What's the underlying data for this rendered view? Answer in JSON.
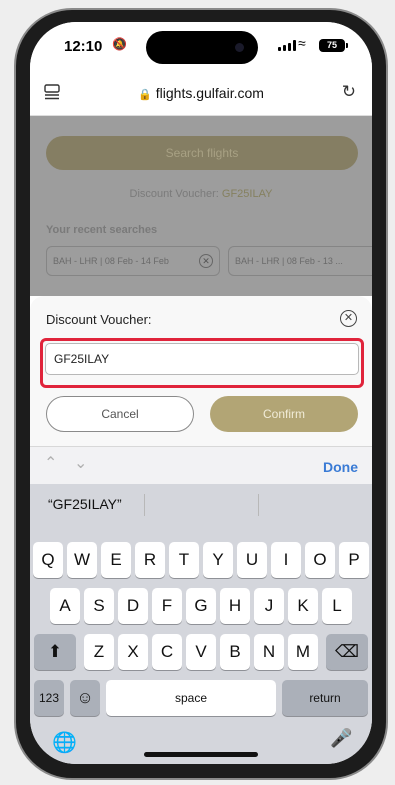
{
  "status_bar": {
    "time": "12:10",
    "battery": "75"
  },
  "browser": {
    "url": "flights.gulfair.com"
  },
  "page": {
    "search_button": "Search flights",
    "discount_label": "Discount Voucher:",
    "discount_code": "GF25ILAY",
    "recent_title": "Your recent searches",
    "recent_searches": [
      "BAH - LHR | 08 Feb - 14 Feb",
      "BAH - LHR | 08 Feb - 13 ..."
    ]
  },
  "dialog": {
    "title": "Discount Voucher:",
    "input_value": "GF25ILAY",
    "cancel_label": "Cancel",
    "confirm_label": "Confirm"
  },
  "keyboard": {
    "done_label": "Done",
    "suggestion": "“GF25ILAY”",
    "row1": [
      "Q",
      "W",
      "E",
      "R",
      "T",
      "Y",
      "U",
      "I",
      "O",
      "P"
    ],
    "row2": [
      "A",
      "S",
      "D",
      "F",
      "G",
      "H",
      "J",
      "K",
      "L"
    ],
    "row3": [
      "Z",
      "X",
      "C",
      "V",
      "B",
      "N",
      "M"
    ],
    "num_key": "123",
    "space_label": "space",
    "return_label": "return"
  },
  "colors": {
    "accent_gold": "#b2a575",
    "highlight_red": "#e0243b",
    "done_blue": "#3a7bd5"
  }
}
